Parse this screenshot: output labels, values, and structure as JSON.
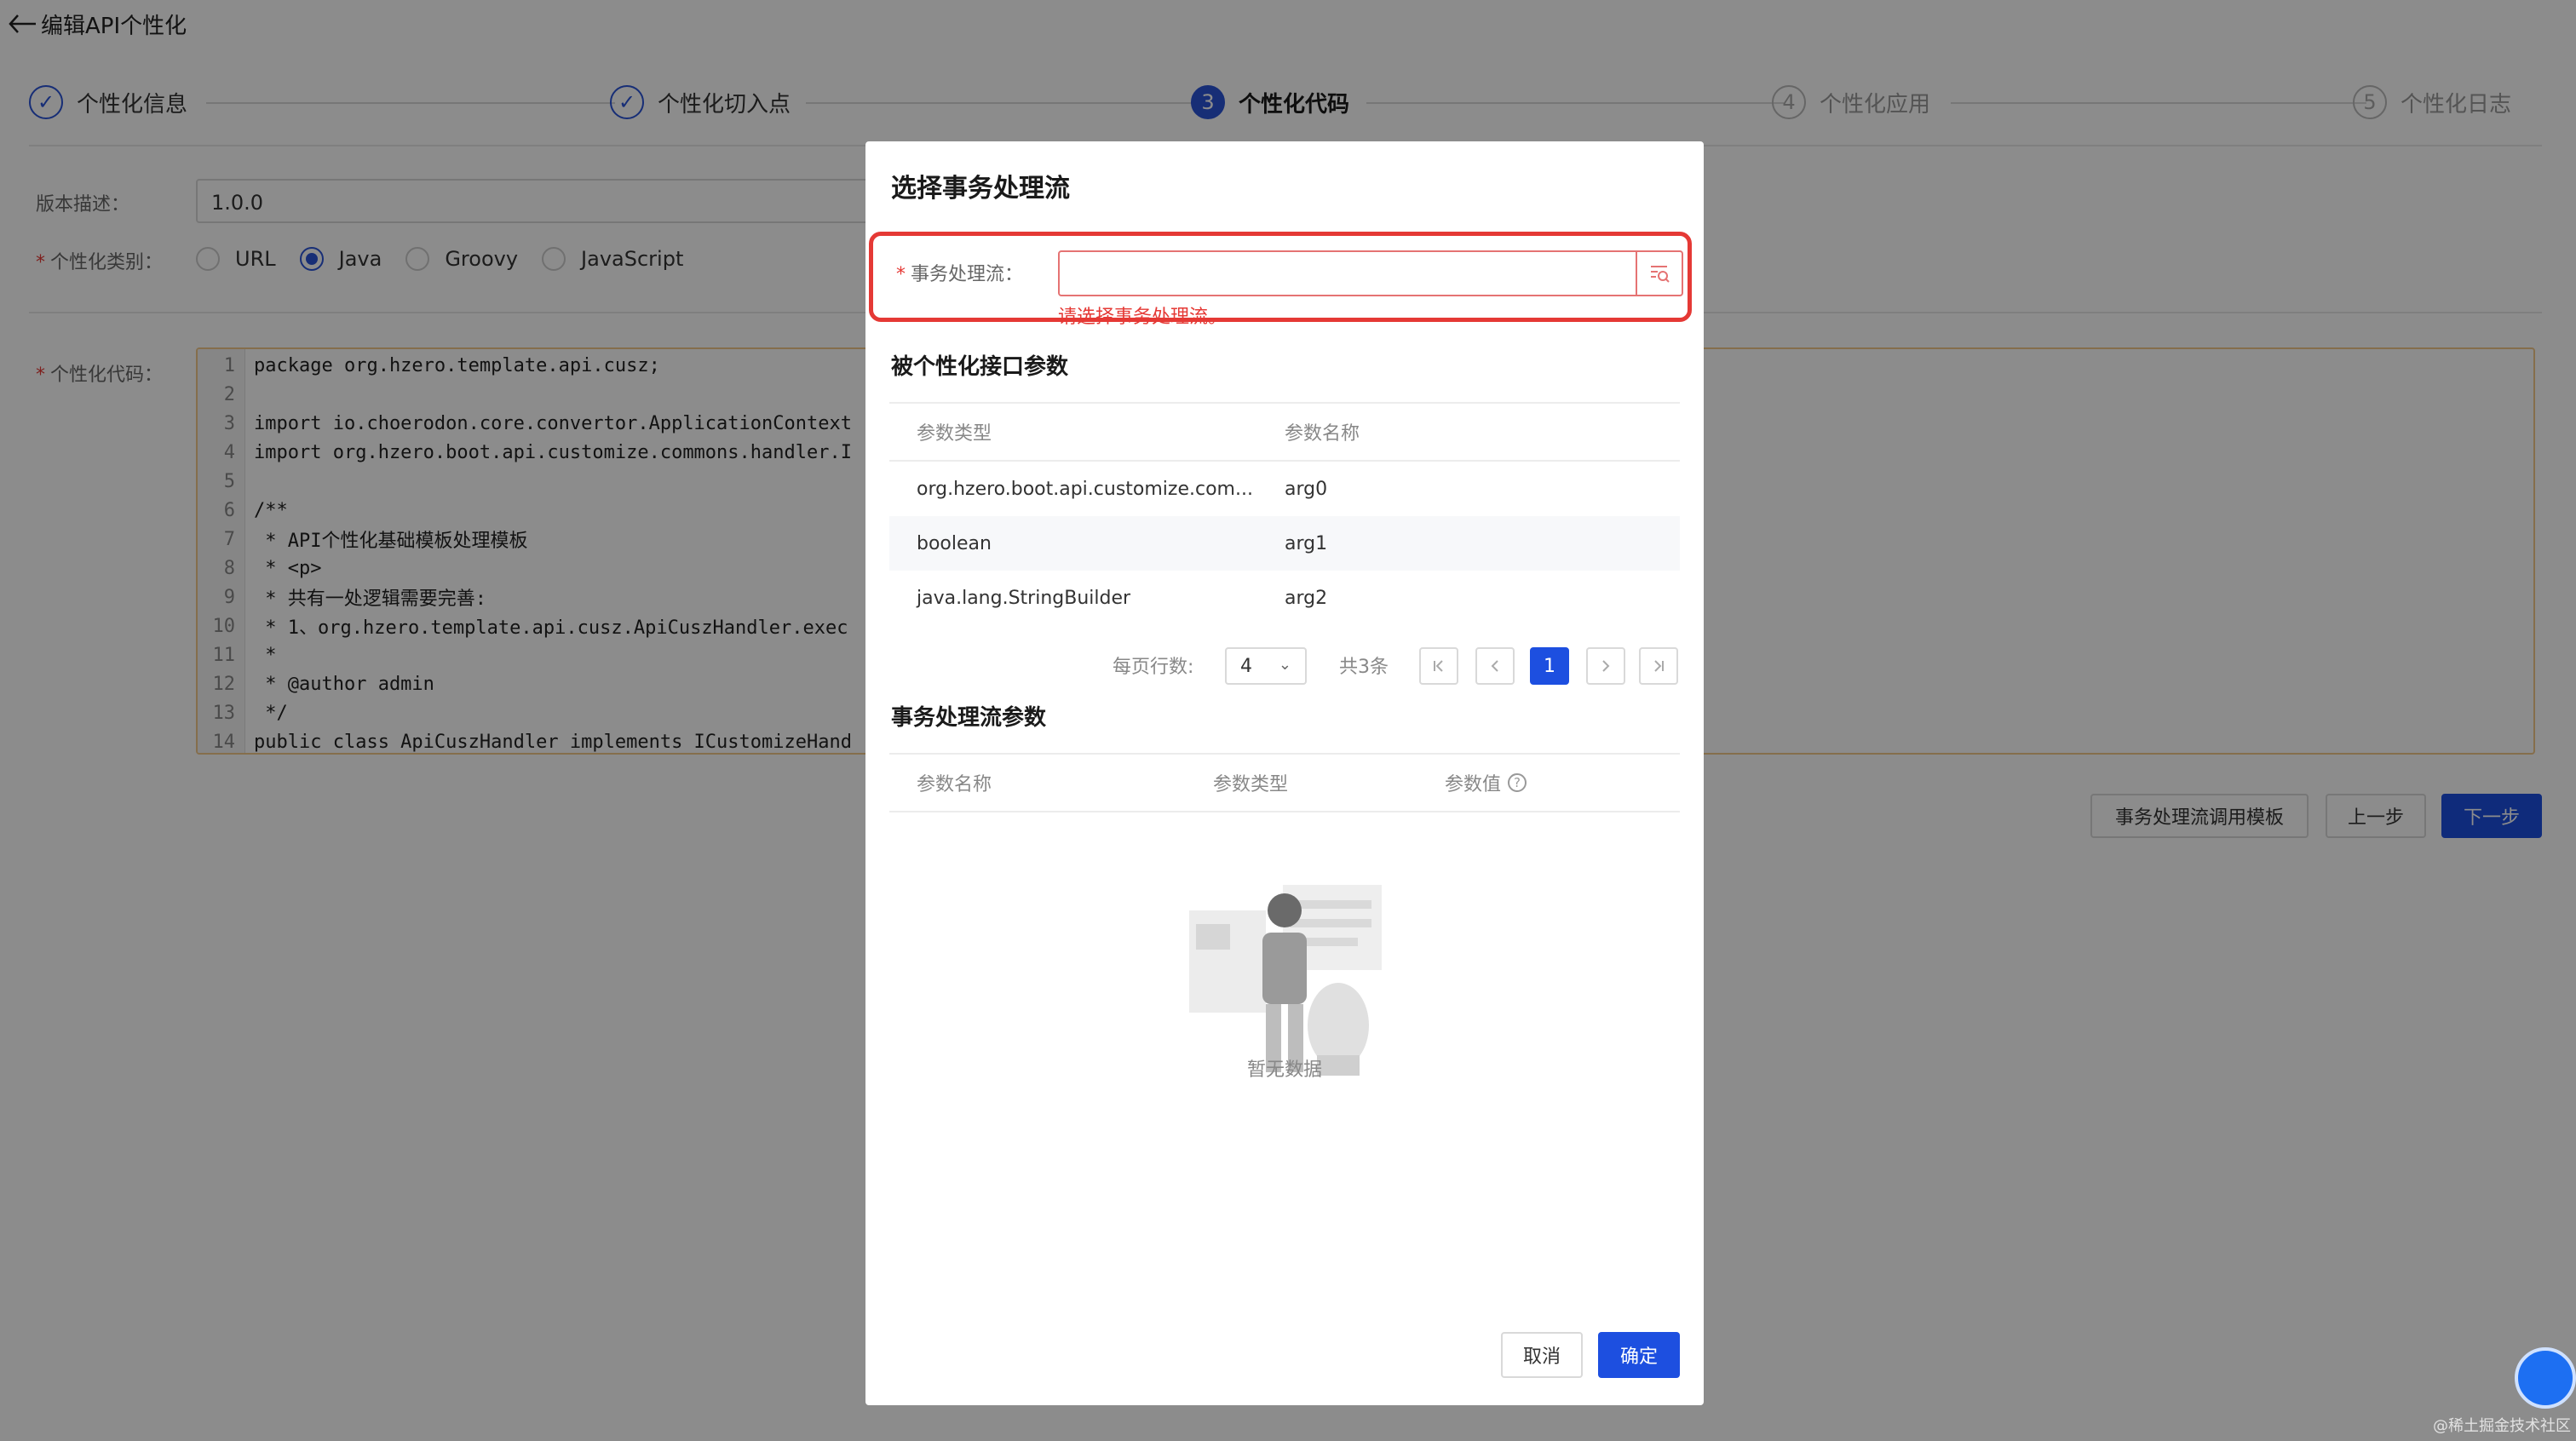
{
  "header": {
    "title": "编辑API个性化"
  },
  "steps": [
    {
      "label": "个性化信息",
      "state": "done",
      "num": ""
    },
    {
      "label": "个性化切入点",
      "state": "done",
      "num": ""
    },
    {
      "label": "个性化代码",
      "state": "active",
      "num": "3"
    },
    {
      "label": "个性化应用",
      "state": "pending",
      "num": "4"
    },
    {
      "label": "个性化日志",
      "state": "pending",
      "num": "5"
    }
  ],
  "form": {
    "version_label": "版本描述：",
    "version_value": "1.0.0",
    "type_label": "个性化类别：",
    "types": [
      "URL",
      "Java",
      "Groovy",
      "JavaScript"
    ],
    "type_selected": "Java",
    "code_label": "个性化代码："
  },
  "code_lines": [
    {
      "n": "1",
      "t": "package org.hzero.template.api.cusz;"
    },
    {
      "n": "2",
      "t": ""
    },
    {
      "n": "3",
      "t": "import io.choerodon.core.convertor.ApplicationContext"
    },
    {
      "n": "4",
      "t": "import org.hzero.boot.api.customize.commons.handler.I"
    },
    {
      "n": "5",
      "t": ""
    },
    {
      "n": "6",
      "t": "/**"
    },
    {
      "n": "7",
      "t": " * API个性化基础模板处理模板"
    },
    {
      "n": "8",
      "t": " * <p>"
    },
    {
      "n": "9",
      "t": " * 共有一处逻辑需要完善:"
    },
    {
      "n": "10",
      "t": " * 1、org.hzero.template.api.cusz.ApiCuszHandler.exec"
    },
    {
      "n": "11",
      "t": " *"
    },
    {
      "n": "12",
      "t": " * @author admin"
    },
    {
      "n": "13",
      "t": " */"
    },
    {
      "n": "14",
      "t": "public class ApiCuszHandler implements ICustomizeHand"
    }
  ],
  "actions": {
    "template": "事务处理流调用模板",
    "prev": "上一步",
    "next": "下一步"
  },
  "modal": {
    "title": "选择事务处理流",
    "field_label": "事务处理流：",
    "field_error": "请选择事务处理流。",
    "section1_title": "被个性化接口参数",
    "table1_headers": [
      "参数类型",
      "参数名称"
    ],
    "table1_rows": [
      [
        "org.hzero.boot.api.customize.com...",
        "arg0"
      ],
      [
        "boolean",
        "arg1"
      ],
      [
        "java.lang.StringBuilder",
        "arg2"
      ]
    ],
    "pager": {
      "rows_label": "每页行数:",
      "page_size": "4",
      "total": "共3条",
      "current": "1"
    },
    "section2_title": "事务处理流参数",
    "table2_headers": [
      "参数名称",
      "参数类型",
      "参数值"
    ],
    "empty_text": "暂无数据",
    "cancel": "取消",
    "ok": "确定"
  },
  "watermark": "@稀土掘金技术社区",
  "colors": {
    "primary": "#1d4fe0",
    "error": "#e53935",
    "code_border": "#f3c98b"
  }
}
